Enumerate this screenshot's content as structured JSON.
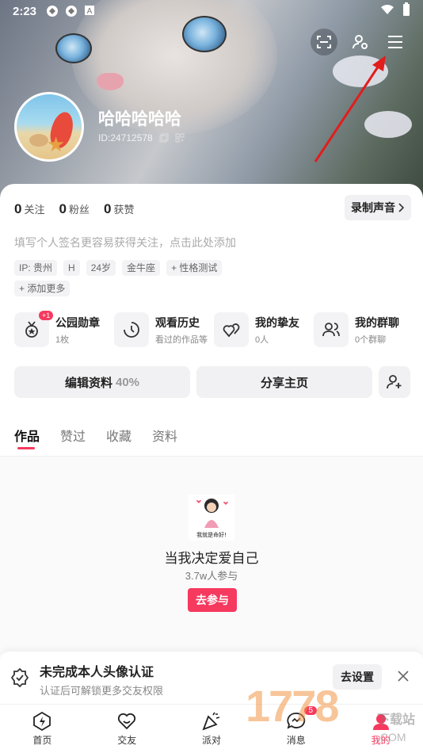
{
  "status_bar": {
    "time": "2:23"
  },
  "profile": {
    "nickname": "哈哈哈哈哈",
    "uid": "ID:24712578",
    "stats": [
      {
        "num": "0",
        "label": "关注"
      },
      {
        "num": "0",
        "label": "粉丝"
      },
      {
        "num": "0",
        "label": "获赞"
      }
    ],
    "voice_button": "录制声音",
    "signature_placeholder": "填写个人签名更容易获得关注，点击此处添加",
    "tags": [
      "IP: 贵州",
      "H",
      "24岁",
      "金牛座",
      "+ 性格测试"
    ],
    "add_more": "+ 添加更多"
  },
  "quick_entries": [
    {
      "title": "公园勋章",
      "sub": "1枚",
      "badge": "+1"
    },
    {
      "title": "观看历史",
      "sub": "看过的作品等"
    },
    {
      "title": "我的挚友",
      "sub": "0人"
    },
    {
      "title": "我的群聊",
      "sub": "0个群聊"
    }
  ],
  "actions": {
    "edit": "编辑资料",
    "edit_pct": "40%",
    "share": "分享主页"
  },
  "tabs": [
    "作品",
    "赞过",
    "收藏",
    "资料"
  ],
  "promo": {
    "image_caption": "我就是命好!",
    "title": "当我决定爱自己",
    "sub": "3.7w人参与",
    "button": "去参与"
  },
  "notice": {
    "title": "未完成本人头像认证",
    "sub": "认证后可解锁更多交友权限",
    "button": "去设置"
  },
  "nav": [
    {
      "label": "首页",
      "icon": "home-icon"
    },
    {
      "label": "交友",
      "icon": "heart-icon"
    },
    {
      "label": "派对",
      "icon": "party-icon"
    },
    {
      "label": "消息",
      "icon": "message-icon",
      "badge": "5"
    },
    {
      "label": "我的",
      "icon": "me-icon"
    }
  ],
  "watermark": {
    "number": "1778",
    "site": "下载站",
    "domain": ".COM"
  },
  "colors": {
    "accent": "#f6395e",
    "card_bg": "#f1f1f3"
  }
}
